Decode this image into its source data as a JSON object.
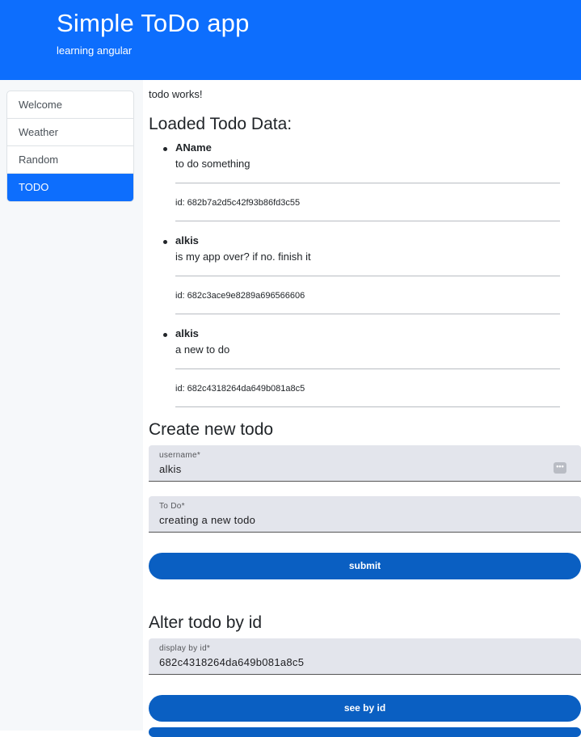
{
  "header": {
    "title": "Simple ToDo app",
    "subtitle": "learning angular"
  },
  "sidebar": {
    "items": [
      {
        "label": "Welcome"
      },
      {
        "label": "Weather"
      },
      {
        "label": "Random"
      },
      {
        "label": "TODO",
        "active": true
      }
    ]
  },
  "main": {
    "works_text": "todo works!",
    "loaded_heading": "Loaded Todo Data:",
    "todos": [
      {
        "name": "AName",
        "text": "to do something",
        "id_label": "id: 682b7a2d5c42f93b86fd3c55"
      },
      {
        "name": "alkis",
        "text": "is my app over? if no. finish it",
        "id_label": "id: 682c3ace9e8289a696566606"
      },
      {
        "name": "alkis",
        "text": "a new to do",
        "id_label": "id: 682c4318264da649b081a8c5"
      }
    ],
    "create": {
      "heading": "Create new todo",
      "username_label": "username*",
      "username_value": "alkis",
      "todo_label": "To Do*",
      "todo_value": "creating a new todo",
      "submit_label": "submit"
    },
    "alter": {
      "heading": "Alter todo by id",
      "id_label": "display by id*",
      "id_value": "682c4318264da649b081a8c5",
      "see_label": "see by id"
    }
  },
  "colors": {
    "accent": "#0d6efd",
    "button": "#0a5fc2",
    "field_bg": "#e3e5ec"
  },
  "icons": {
    "field_menu": "dots-icon"
  }
}
